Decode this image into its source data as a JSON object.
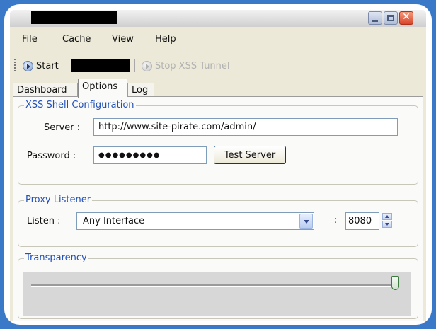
{
  "window": {
    "title": ""
  },
  "menu": {
    "items": [
      "File",
      "Cache",
      "View",
      "Help"
    ]
  },
  "toolbar": {
    "start_label": "Start",
    "stop_label": "Stop XSS Tunnel"
  },
  "tabs": [
    {
      "label": "Dashboard",
      "active": false
    },
    {
      "label": "Options",
      "active": true
    },
    {
      "label": "Log",
      "active": false
    }
  ],
  "xss_config": {
    "title": "XSS Shell Configuration",
    "server_label": "Server :",
    "server_value": "http://www.site-pirate.com/admin/",
    "password_label": "Password :",
    "password_value": "●●●●●●●●●",
    "test_button": "Test Server"
  },
  "proxy": {
    "title": "Proxy Listener",
    "listen_label": "Listen :",
    "interface_value": "Any Interface",
    "port_separator": ":",
    "port_value": "8080"
  },
  "transparency": {
    "title": "Transparency",
    "level": 1.0
  },
  "colors": {
    "group_title": "#2150b9",
    "background": "#ece9d8",
    "accent_frame": "#3a78c8"
  }
}
